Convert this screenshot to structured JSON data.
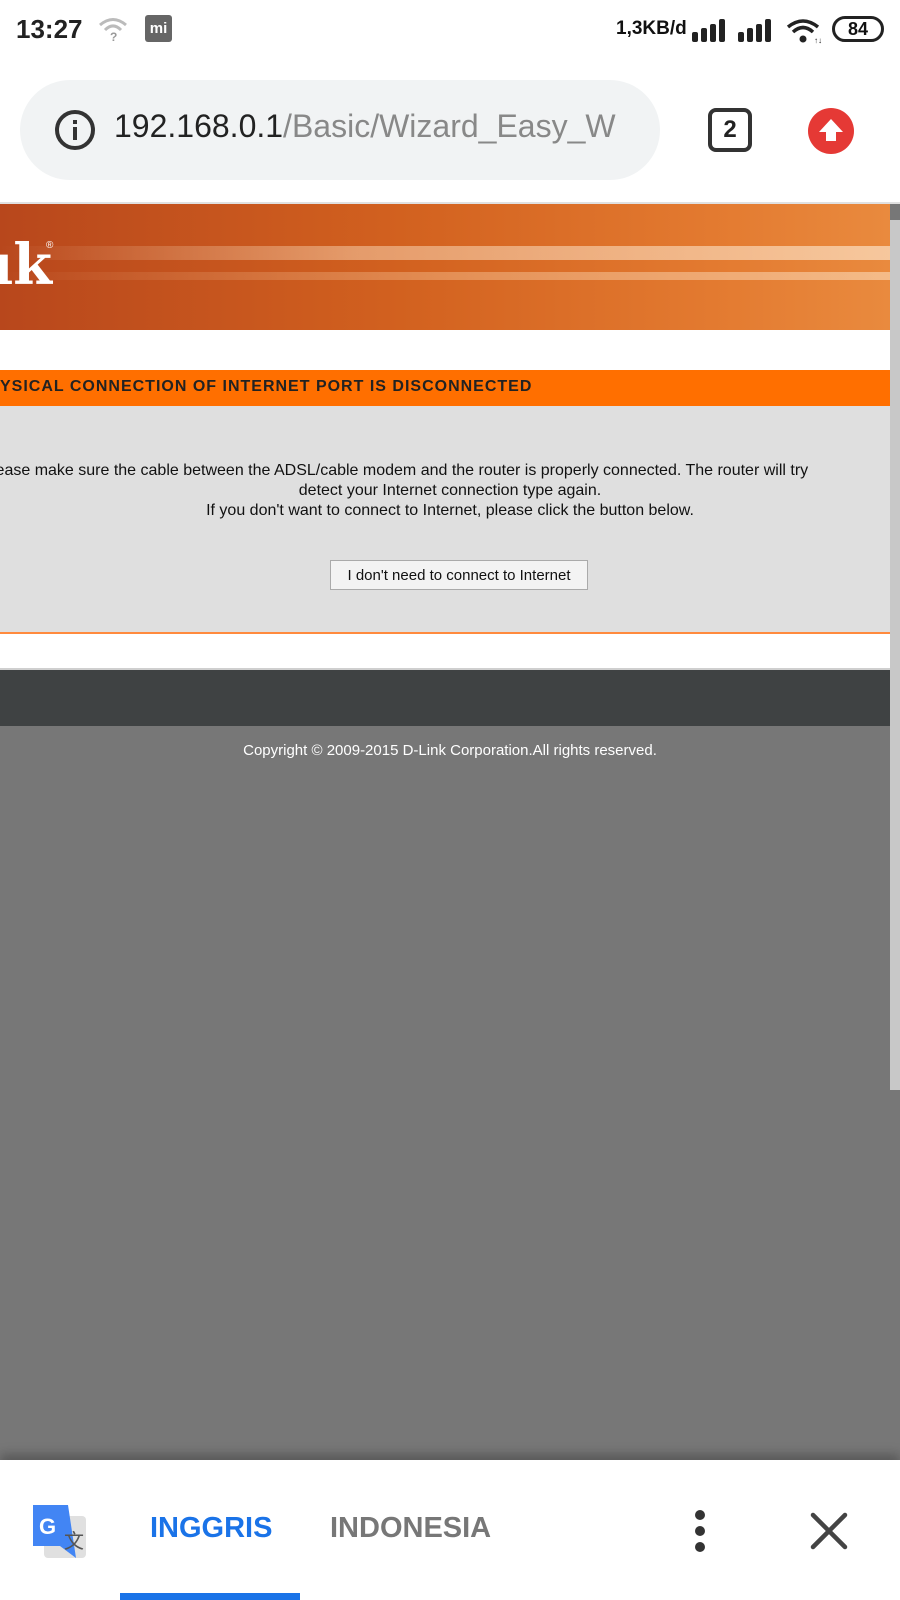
{
  "status_bar": {
    "time": "13:27",
    "mi_label": "mi",
    "net_speed": "1,3KB/d",
    "battery": "84",
    "icons": [
      "wifi-question-icon",
      "mi-icon",
      "signal-icon",
      "signal-icon",
      "wifi-icon"
    ]
  },
  "browser": {
    "url_host": "192.168.0.1",
    "url_path": "/Basic/Wizard_Easy_W",
    "tab_count": "2",
    "icons": [
      "info-icon",
      "update-icon"
    ]
  },
  "page": {
    "banner_logo": "ık",
    "banner_reg": "®",
    "alert_title": "YSICAL CONNECTION OF INTERNET PORT IS DISCONNECTED",
    "message_line1": "lease make sure the cable between the ADSL/cable modem and the router is properly connected. The router will try",
    "message_line2": "detect your Internet connection type again.",
    "message_line3": "If you don't want to connect to Internet, please click the button below.",
    "skip_button_label": "I don't need to connect to Internet",
    "copyright": "Copyright © 2009-2015 D-Link Corporation.All rights reserved.",
    "colors": {
      "banner": "#d2611f",
      "alert": "#ff6f00",
      "footer": "#3f4243"
    }
  },
  "translate_bar": {
    "source_lang": "INGGRIS",
    "target_lang": "INDONESIA",
    "active": "INGGRIS",
    "icons": [
      "google-translate-icon",
      "more-vert-icon",
      "close-icon"
    ]
  }
}
